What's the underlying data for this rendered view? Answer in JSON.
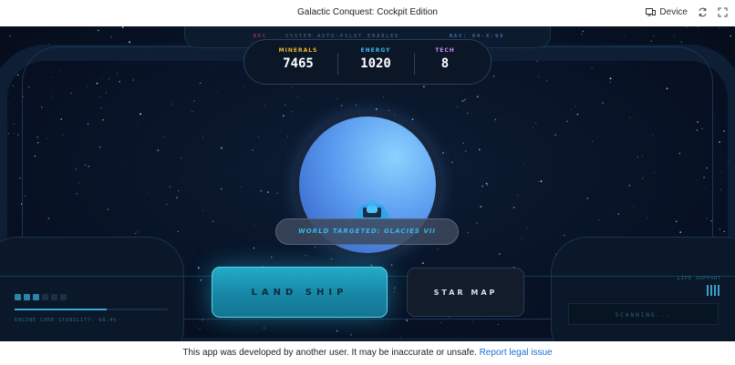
{
  "window": {
    "title": "Galactic Conquest: Cockpit Edition",
    "device_label": "Device",
    "icons": [
      "device-icon",
      "refresh-icon",
      "fullscreen-icon"
    ]
  },
  "hud": {
    "rec_label": "REC",
    "status_text": "SYSTEM AUTO-PILOT ENABLED",
    "nav_text": "NAV: 04-X-99"
  },
  "resources": {
    "minerals": {
      "label": "MINERALS",
      "value": "7465",
      "color": "#f2b733"
    },
    "energy": {
      "label": "ENERGY",
      "value": "1020",
      "color": "#3fb6ee"
    },
    "tech": {
      "label": "TECH",
      "value": "8",
      "color": "#c58cf0"
    }
  },
  "planet": {
    "target_text": "WORLD TARGETED: GLACIES VII",
    "color": "#5b9cf0"
  },
  "controls": {
    "land_label": "LAND SHIP",
    "map_label": "STAR MAP"
  },
  "left_console": {
    "pips_total": 6,
    "pips_on": 3,
    "stability_fraction": 0.6,
    "stability_text": "ENGINE CORE STABILITY: 98.4%"
  },
  "right_console": {
    "life_label": "LIFE SUPPORT",
    "scanning_text": "SCANNING..."
  },
  "footer": {
    "notice": "This app was developed by another user. It may be inaccurate or unsafe.",
    "link": "Report legal issue"
  }
}
